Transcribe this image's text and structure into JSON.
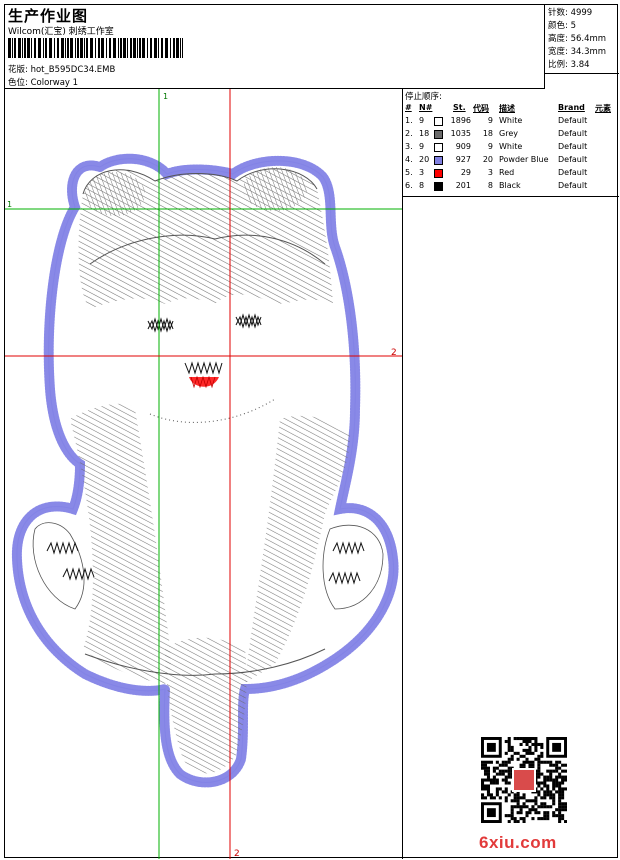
{
  "header": {
    "title": "生产作业图",
    "subtitle": "Wilcom(汇宝) 刺绣工作室",
    "design_label": "花版:",
    "design_name": "hot_B595DC34.EMB",
    "colorway_label": "色位:",
    "colorway_name": "Colorway 1"
  },
  "stats": {
    "stitches_label": "针数:",
    "stitches": "4999",
    "colors_label": "颜色:",
    "colors": "5",
    "height_label": "高度:",
    "height": "56.4mm",
    "width_label": "宽度:",
    "width": "34.3mm",
    "scale_label": "比例:",
    "scale": "3.84"
  },
  "guides": {
    "v1": "1",
    "h1": "1",
    "h2": "2",
    "v2": "2"
  },
  "color_table": {
    "title": "停止顺序:",
    "headers": [
      "#",
      "N#",
      "St.",
      "代码",
      "描述",
      "Brand",
      "元素"
    ],
    "rows": [
      {
        "idx": "1.",
        "n": "9",
        "st": "1896",
        "code": "9",
        "desc": "White",
        "brand": "Default",
        "color": "#ffffff"
      },
      {
        "idx": "2.",
        "n": "18",
        "st": "1035",
        "code": "18",
        "desc": "Grey",
        "brand": "Default",
        "color": "#6b6b6b"
      },
      {
        "idx": "3.",
        "n": "9",
        "st": "909",
        "code": "9",
        "desc": "White",
        "brand": "Default",
        "color": "#ffffff"
      },
      {
        "idx": "4.",
        "n": "20",
        "st": "927",
        "code": "20",
        "desc": "Powder Blue",
        "brand": "Default",
        "color": "#8080e0"
      },
      {
        "idx": "5.",
        "n": "3",
        "st": "29",
        "code": "3",
        "desc": "Red",
        "brand": "Default",
        "color": "#ff0000"
      },
      {
        "idx": "6.",
        "n": "8",
        "st": "201",
        "code": "8",
        "desc": "Black",
        "brand": "Default",
        "color": "#000000"
      }
    ]
  },
  "footer": {
    "site_a": "6xiu",
    "site_b": ".com"
  }
}
